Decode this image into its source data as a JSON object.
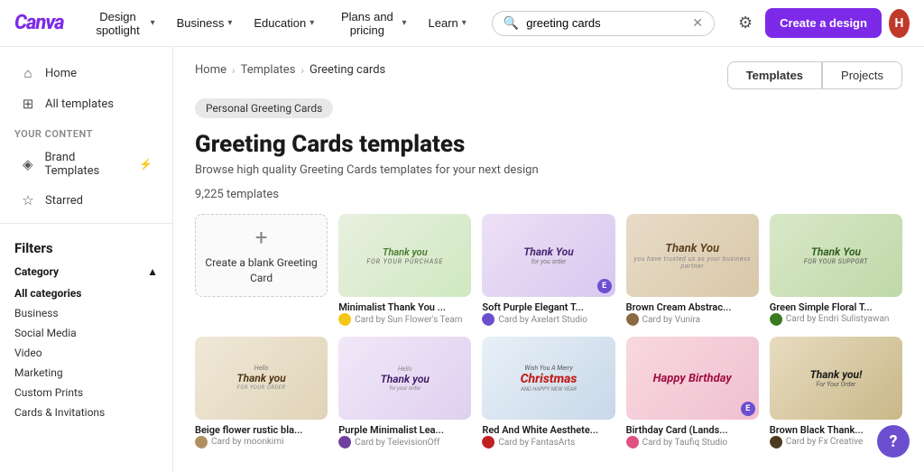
{
  "topnav": {
    "logo": "Canva",
    "nav_items": [
      {
        "label": "Design spotlight",
        "id": "design-spotlight"
      },
      {
        "label": "Business",
        "id": "business"
      },
      {
        "label": "Education",
        "id": "education"
      },
      {
        "label": "Plans and pricing",
        "id": "plans-pricing"
      },
      {
        "label": "Learn",
        "id": "learn"
      }
    ],
    "search_placeholder": "greeting cards",
    "search_value": "greeting cards",
    "create_label": "Create a design",
    "avatar_letter": "H"
  },
  "sidebar": {
    "nav_items": [
      {
        "id": "home",
        "icon": "⌂",
        "label": "Home"
      },
      {
        "id": "all-templates",
        "icon": "⊞",
        "label": "All templates"
      }
    ],
    "section_label": "Your Content",
    "content_items": [
      {
        "id": "brand-templates",
        "icon": "◈",
        "label": "Brand Templates",
        "badge": "⚡"
      },
      {
        "id": "starred",
        "icon": "☆",
        "label": "Starred"
      }
    ],
    "filters_header": "Filters",
    "filter_category_title": "Category",
    "filter_items": [
      {
        "label": "All categories",
        "active": true
      },
      {
        "label": "Business",
        "active": false
      },
      {
        "label": "Social Media",
        "active": false
      },
      {
        "label": "Video",
        "active": false
      },
      {
        "label": "Marketing",
        "active": false
      },
      {
        "label": "Custom Prints",
        "active": false
      },
      {
        "label": "Cards & Invitations",
        "active": false
      }
    ]
  },
  "main": {
    "breadcrumb": [
      "Home",
      "Templates",
      "Greeting cards"
    ],
    "filter_tag": "Personal Greeting Cards",
    "page_title": "Greeting Cards templates",
    "page_desc": "Browse high quality Greeting Cards templates for your next design",
    "template_count": "9,225 templates",
    "tabs": [
      {
        "label": "Templates",
        "active": true
      },
      {
        "label": "Projects",
        "active": false
      }
    ],
    "create_blank": {
      "label": "Create a blank Greeting Card",
      "plus": "+"
    },
    "templates": [
      {
        "id": "minimalist-thank-you",
        "label": "Minimalist Thank You ...",
        "author": "Card by Sun Flower's Team",
        "bg": "#e8f0e0",
        "text": "Thank you\nFOR YOUR PURCHASE",
        "has_badge": false
      },
      {
        "id": "soft-purple-elegant",
        "label": "Soft Purple Elegant T...",
        "author": "Card by Axelart Studio",
        "bg": "#ede0f5",
        "text": "Thank You\nfor you order",
        "has_badge": true
      },
      {
        "id": "brown-cream-abstract",
        "label": "Brown Cream Abstrac...",
        "author": "Card by Vunira",
        "bg": "#e8dcc8",
        "text": "Thank You",
        "has_badge": false
      },
      {
        "id": "green-simple-floral",
        "label": "Green Simple Floral T...",
        "author": "Card by Endri Sulistyawan",
        "bg": "#d8e8c8",
        "text": "Thank You\nFOR YOUR SUPPORT",
        "has_badge": false
      },
      {
        "id": "beige-flower-rustic",
        "label": "Beige flower rustic bla...",
        "author": "Card by moonkimi",
        "bg": "#f0e8d8",
        "text": "Hello\nThank you\nFOR YOUR ORDER",
        "has_badge": false
      },
      {
        "id": "purple-minimalist-lea",
        "label": "Purple Minimalist Lea...",
        "author": "Card by TelevisionOff",
        "bg": "#f0e8f8",
        "text": "Hello\nThank you\nfor your order",
        "has_badge": false
      },
      {
        "id": "red-white-aesthetic",
        "label": "Red And White Aesthete...",
        "author": "Card by FantasArts",
        "bg": "#c8e0f0",
        "text": "Wish You A Merry\nChristmas",
        "has_badge": false
      },
      {
        "id": "birthday-card",
        "label": "Birthday Card (Lands...",
        "author": "Card by Taufiq Studio",
        "bg": "#f8d8e0",
        "text": "Happy Birthday",
        "has_badge": true
      },
      {
        "id": "brown-black-thank",
        "label": "Brown Black Thank...",
        "author": "Card by Fx Creative",
        "bg": "#e8dcc0",
        "text": "Thank you!\nFor Your Order",
        "has_badge": false
      }
    ]
  },
  "help_btn": "?"
}
